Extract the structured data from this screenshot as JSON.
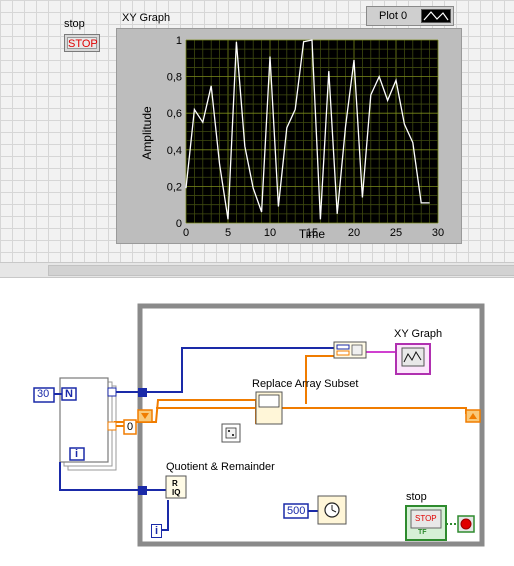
{
  "front_panel": {
    "stop_label": "stop",
    "stop_button_text": "STOP",
    "graph_label": "XY Graph",
    "plot_legend": "Plot 0",
    "ylabel": "Amplitude",
    "xlabel": "Time"
  },
  "chart_data": {
    "type": "line",
    "title": "XY Graph",
    "xlabel": "Time",
    "ylabel": "Amplitude",
    "xlim": [
      0,
      30
    ],
    "ylim": [
      0,
      1
    ],
    "x_ticks": [
      "0",
      "5",
      "10",
      "15",
      "20",
      "25",
      "30"
    ],
    "y_ticks": [
      "0",
      "0,2",
      "0,4",
      "0,6",
      "0,8",
      "1"
    ],
    "grid": true,
    "series": [
      {
        "name": "Plot 0",
        "color": "#ffffff",
        "x": [
          0,
          1,
          2,
          3,
          4,
          5,
          6,
          7,
          8,
          9,
          10,
          11,
          12,
          13,
          14,
          15,
          16,
          17,
          18,
          19,
          20,
          21,
          22,
          23,
          24,
          25,
          26,
          27,
          28,
          29
        ],
        "y": [
          0.19,
          0.62,
          0.55,
          0.75,
          0.32,
          0.02,
          0.99,
          0.42,
          0.19,
          0.06,
          0.91,
          0.09,
          0.52,
          0.62,
          0.99,
          1.0,
          0.02,
          0.83,
          0.05,
          0.53,
          0.89,
          0.14,
          0.7,
          0.8,
          0.67,
          0.78,
          0.54,
          0.44,
          0.11,
          0.11
        ]
      }
    ]
  },
  "block_diagram": {
    "loop_count_value": "30",
    "count_terminal": "N",
    "iteration_terminal": "i",
    "constant_zero": "0",
    "replace_label": "Replace Array Subset",
    "quotient_label": "Quotient & Remainder",
    "xy_graph_label": "XY Graph",
    "stop_label": "stop",
    "stop_terminal_text": "STOP",
    "stop_terminal_type": "TF",
    "wait_value": "500",
    "colors": {
      "blue_wire": "#1a2aa8",
      "orange_wire": "#f07c00",
      "pink_wire": "#d040d0",
      "stop_green": "#2e8b2e"
    }
  }
}
